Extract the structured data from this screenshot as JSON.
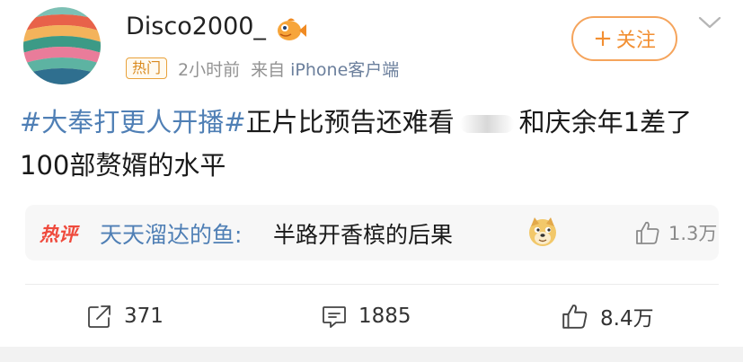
{
  "user": {
    "name": "Disco2000_",
    "badge_icon": "fish-badge-icon"
  },
  "meta": {
    "hot_tag": "热门",
    "time": "2小时前",
    "from_label": "来自",
    "source": "iPhone客户端"
  },
  "follow_button": {
    "plus": "+",
    "label": "关注"
  },
  "post": {
    "hashtag": "#大奉打更人开播#",
    "text_part1": "正片比预告还难看",
    "text_part2": "和庆余年1差了100部赘婿的水平"
  },
  "hot_comment": {
    "label": "热评",
    "author": "天天溜达的鱼:",
    "text": "半路开香槟的后果",
    "emoji": "doge-icon",
    "likes": "1.3万"
  },
  "actions": {
    "repost_count": "371",
    "comment_count": "1885",
    "like_count": "8.4万"
  },
  "colors": {
    "accent_orange": "#f28f32",
    "link_blue": "#4f7fb5",
    "hot_red": "#ef4a3c"
  }
}
